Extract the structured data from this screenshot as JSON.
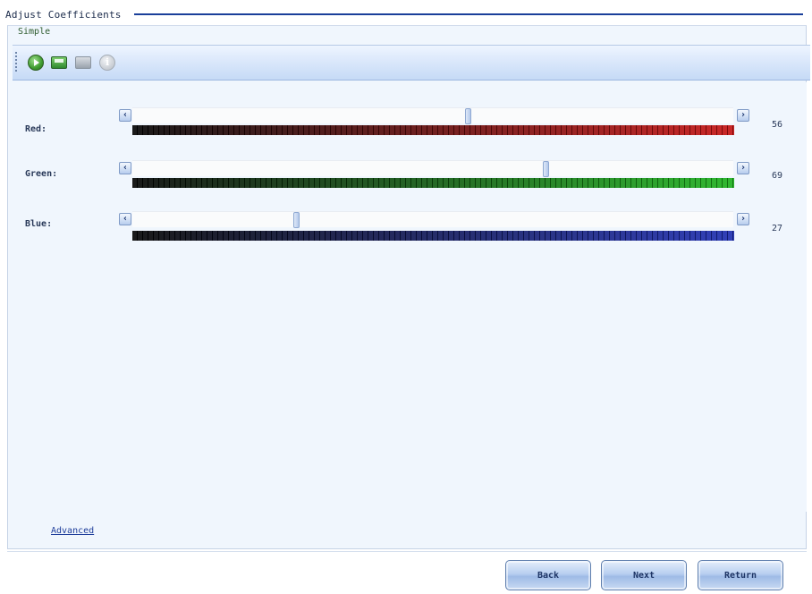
{
  "window": {
    "title": "Adjust Coefficients"
  },
  "group": {
    "label": "Simple"
  },
  "toolbar": {
    "icons": [
      "run-icon",
      "save-icon",
      "open-icon",
      "info-icon"
    ]
  },
  "sliders": [
    {
      "label": "Red:",
      "value": "56",
      "value_fraction": 0.56,
      "color": "#c41010"
    },
    {
      "label": "Green:",
      "value": "69",
      "value_fraction": 0.69,
      "color": "#1ab01a"
    },
    {
      "label": "Blue:",
      "value": "27",
      "value_fraction": 0.27,
      "color": "#1a2ab0"
    }
  ],
  "arrows": {
    "left": "‹",
    "right": "›"
  },
  "links": {
    "advanced": "Advanced"
  },
  "buttons": {
    "back": "Back",
    "next": "Next",
    "return": "Return"
  }
}
